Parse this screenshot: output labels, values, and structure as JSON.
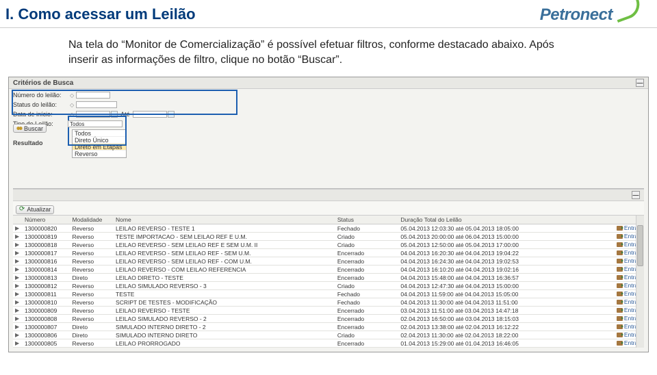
{
  "header": {
    "title": "I. Como acessar um Leilão",
    "brand": "Petronect"
  },
  "body_text": "Na tela do “Monitor de Comercialização” é possível efetuar filtros, conforme destacado abaixo. Após inserir as informações de filtro, clique no botão “Buscar”.",
  "panel": {
    "criteria_title": "Critérios de Busca",
    "filters": {
      "numero_label": "Número do leilão:",
      "status_label": "Status do leilão:",
      "data_inicio_label": "Data de início:",
      "ate_label": "Até",
      "tipo_label": "Tipo de Leilão:",
      "tipo_selected": "Todos",
      "tipo_options": [
        "Todos",
        "Direto Único",
        "Direto em Etapas",
        "Reverso"
      ],
      "buscar_label": "Buscar"
    },
    "resultado_label": "Resultado",
    "atualizar_label": "Atualizar",
    "columns": {
      "numero": "Número",
      "modalidade": "Modalidade",
      "nome": "Nome",
      "status": "Status",
      "duracao": "Duração Total do Leilão",
      "entrar": "Entrar"
    },
    "rows": [
      {
        "numero": "1300000820",
        "modalidade": "Reverso",
        "nome": "LEILAO REVERSO - TESTE 1",
        "status": "Fechado",
        "duracao": "05.04.2013 12:03:30 até 05.04.2013 18:05:00"
      },
      {
        "numero": "1300000819",
        "modalidade": "Reverso",
        "nome": "TESTE IMPORTACAO - SEM LEILAO REF E U.M.",
        "status": "Criado",
        "duracao": "05.04.2013 20:00:00 até 06.04.2013 15:00:00"
      },
      {
        "numero": "1300000818",
        "modalidade": "Reverso",
        "nome": "LEILAO REVERSO - SEM LEILAO REF E SEM U.M. II",
        "status": "Criado",
        "duracao": "05.04.2013 12:50:00 até 05.04.2013 17:00:00"
      },
      {
        "numero": "1300000817",
        "modalidade": "Reverso",
        "nome": "LEILAO REVERSO - SEM LEILAO REF - SEM U.M.",
        "status": "Encerrado",
        "duracao": "04.04.2013 16:20:30 até 04.04.2013 19:04:22"
      },
      {
        "numero": "1300000816",
        "modalidade": "Reverso",
        "nome": "LEILAO REVERSO - SEM LEILAO REF - COM U.M.",
        "status": "Encerrado",
        "duracao": "04.04.2013 16:24:30 até 04.04.2013 19:02:53"
      },
      {
        "numero": "1300000814",
        "modalidade": "Reverso",
        "nome": "LEILAO REVERSO - COM LEILAO REFERENCIA",
        "status": "Encerrado",
        "duracao": "04.04.2013 16:10:20 até 04.04.2013 19:02:16"
      },
      {
        "numero": "1300000813",
        "modalidade": "Direto",
        "nome": "LEILAO DIRETO - TESTE",
        "status": "Encerrado",
        "duracao": "04.04.2013 15:48:00 até 04.04.2013 16:36:57"
      },
      {
        "numero": "1300000812",
        "modalidade": "Reverso",
        "nome": "LEILAO SIMULADO REVERSO - 3",
        "status": "Criado",
        "duracao": "04.04.2013 12:47:30 até 04.04.2013 15:00:00"
      },
      {
        "numero": "1300000811",
        "modalidade": "Reverso",
        "nome": "TESTE",
        "status": "Fechado",
        "duracao": "04.04.2013 11:59:00 até 04.04.2013 15:05:00"
      },
      {
        "numero": "1300000810",
        "modalidade": "Reverso",
        "nome": "SCRIPT DE TESTES - MODIFICAÇÃO",
        "status": "Fechado",
        "duracao": "04.04.2013 11:30:00 até 04.04.2013 11:51:00"
      },
      {
        "numero": "1300000809",
        "modalidade": "Reverso",
        "nome": "LEILAO REVERSO - TESTE",
        "status": "Encerrado",
        "duracao": "03.04.2013 11:51:00 até 03.04.2013 14:47:18"
      },
      {
        "numero": "1300000808",
        "modalidade": "Reverso",
        "nome": "LEILAO SIMULADO REVERSO - 2",
        "status": "Encerrado",
        "duracao": "02.04.2013 16:50:00 até 03.04.2013 18:15:03"
      },
      {
        "numero": "1300000807",
        "modalidade": "Direto",
        "nome": "SIMULADO INTERNO DIRETO - 2",
        "status": "Encerrado",
        "duracao": "02.04.2013 13:38:00 até 02.04.2013 16:12:22"
      },
      {
        "numero": "1300000806",
        "modalidade": "Direto",
        "nome": "SIMULADO INTERNO DIRETO",
        "status": "Criado",
        "duracao": "02.04.2013 11:30:00 até 02.04.2013 18:22:00"
      },
      {
        "numero": "1300000805",
        "modalidade": "Reverso",
        "nome": "LEILAO PRORROGADO",
        "status": "Encerrado",
        "duracao": "01.04.2013 15:29:00 até 01.04.2013 16:46:05"
      }
    ]
  }
}
